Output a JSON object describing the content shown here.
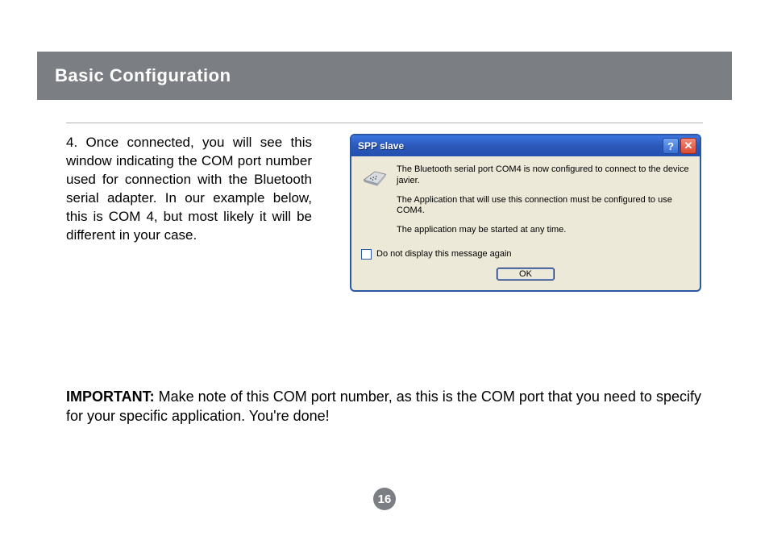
{
  "header": {
    "title": "Basic Configuration"
  },
  "body": {
    "left_paragraph": "4. Once connected, you will see this window indicating the COM port number used for connection with the Bluetooth serial adapter. In our example below, this is COM 4, but most likely it will be different in your case."
  },
  "dialog": {
    "title": "SPP slave",
    "help_glyph": "?",
    "close_glyph": "✕",
    "icon_name": "serial-connector-icon",
    "line1": "The Bluetooth serial port COM4 is now configured to connect to the device javier.",
    "line2": "The Application that will use this connection must be configured to use COM4.",
    "line3": "The application may be started at any time.",
    "checkbox_label": "Do not display this message again",
    "checkbox_checked": false,
    "ok_label": "OK"
  },
  "important": {
    "label": "IMPORTANT:  ",
    "text": "Make note of this COM port number, as this is the COM port that you need to specify for your specific application. You're done!"
  },
  "page_number": "16"
}
